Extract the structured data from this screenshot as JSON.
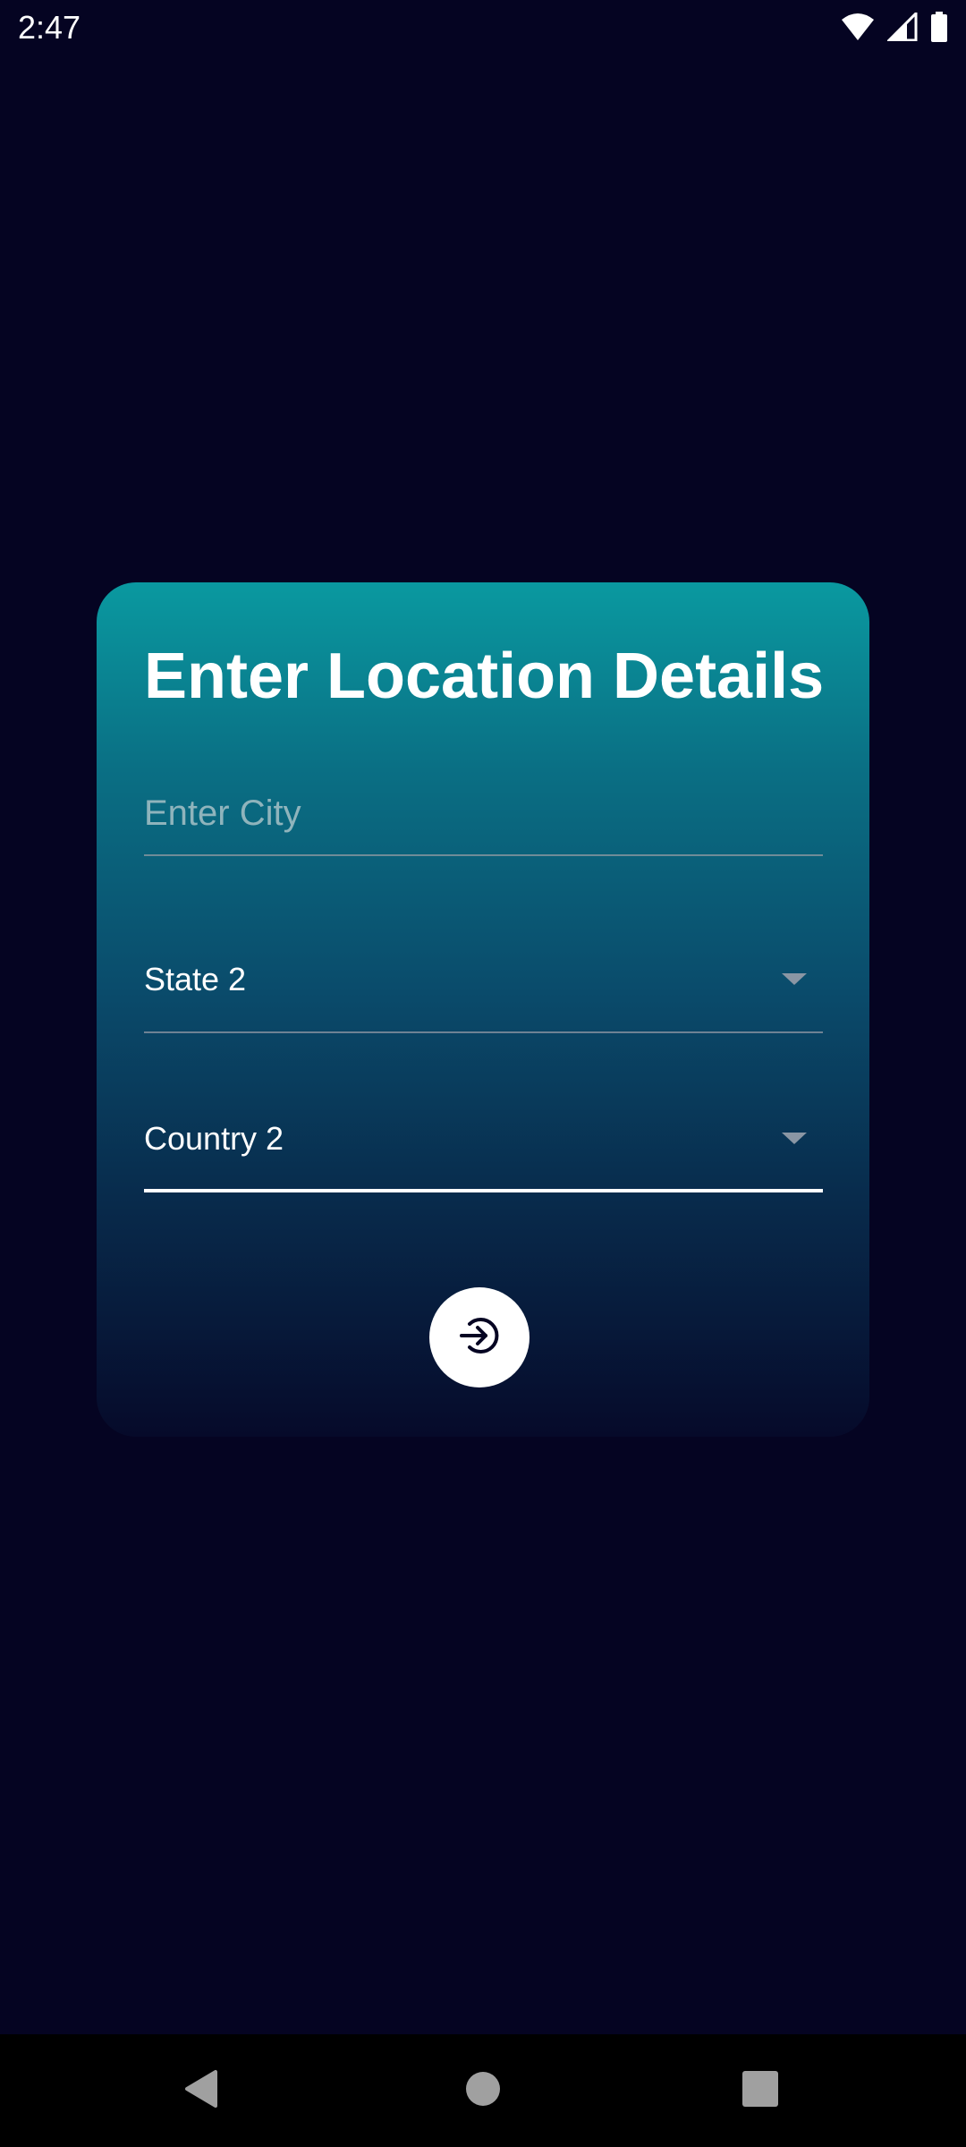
{
  "status_bar": {
    "time": "2:47",
    "icons": [
      "wifi-icon",
      "cellular-signal-icon",
      "battery-icon"
    ]
  },
  "form": {
    "title": "Enter Location Details",
    "city": {
      "placeholder": "Enter City",
      "value": ""
    },
    "state": {
      "selected": "State 2"
    },
    "country": {
      "selected": "Country 2",
      "focused": true
    },
    "submit_icon": "arrow-right-circle-icon"
  },
  "nav_bar": {
    "buttons": [
      "back-icon",
      "home-icon",
      "recents-icon"
    ]
  },
  "colors": {
    "background": "#050422",
    "card_gradient_top": "#0a99a0",
    "card_gradient_bottom": "#060a2a",
    "text": "#ffffff",
    "placeholder": "#8fb4bc",
    "nav_bar": "#000000"
  }
}
